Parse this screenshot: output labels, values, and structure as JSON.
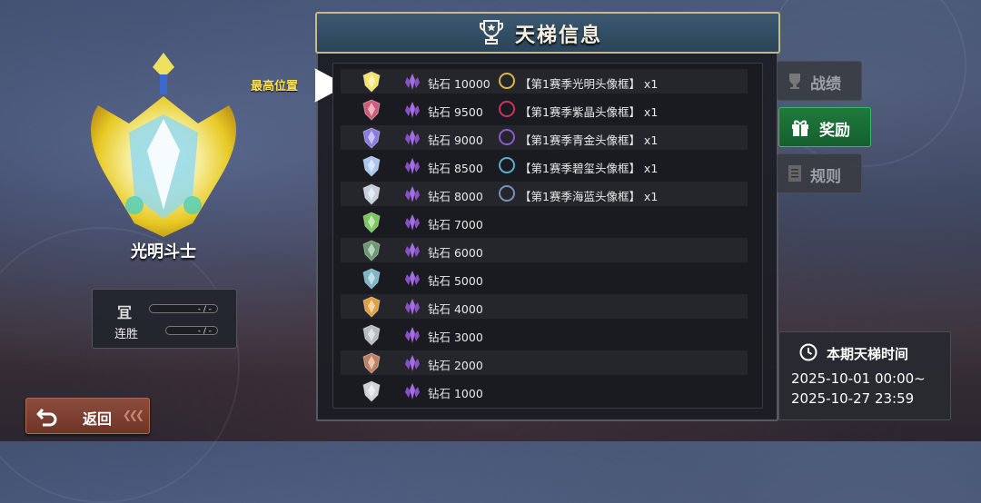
{
  "title": "天梯信息",
  "rank": {
    "name": "光明斗士"
  },
  "stats": {
    "row1_icon": "冝",
    "row1_value": "- / -",
    "row2_label": "连胜",
    "row2_value": "- / -"
  },
  "back_label": "返回",
  "highest_label": "最高位置",
  "tabs": [
    {
      "label": "战绩",
      "active": false,
      "icon": "trophy-icon"
    },
    {
      "label": "奖励",
      "active": true,
      "icon": "gift-icon"
    },
    {
      "label": "规则",
      "active": false,
      "icon": "document-icon"
    }
  ],
  "season": {
    "title": "本期天梯时间",
    "start": "2025-10-01 00:00~",
    "end": "2025-10-27 23:59"
  },
  "tiers": [
    {
      "label": "钻石 10000",
      "reward": "【第1赛季光明头像框】 x1",
      "rank_color": "#f6e46a",
      "ring_color": "#d9b64a"
    },
    {
      "label": "钻石 9500",
      "reward": "【第1赛季紫晶头像框】 x1",
      "rank_color": "#d05a7a",
      "ring_color": "#c8345a"
    },
    {
      "label": "钻石 9000",
      "reward": "【第1赛季青金头像框】 x1",
      "rank_color": "#8a7be0",
      "ring_color": "#8a5ad0"
    },
    {
      "label": "钻石 8500",
      "reward": "【第1赛季碧玺头像框】 x1",
      "rank_color": "#a8c8f0",
      "ring_color": "#5ab0c8"
    },
    {
      "label": "钻石 8000",
      "reward": "【第1赛季海蓝头像框】 x1",
      "rank_color": "#c8d0e0",
      "ring_color": "#7a90b8"
    },
    {
      "label": "钻石 7000",
      "reward": "",
      "rank_color": "#7ac85a"
    },
    {
      "label": "钻石 6000",
      "reward": "",
      "rank_color": "#6a9a70"
    },
    {
      "label": "钻石 5000",
      "reward": "",
      "rank_color": "#7ab8c8"
    },
    {
      "label": "钻石 4000",
      "reward": "",
      "rank_color": "#e0a040"
    },
    {
      "label": "钻石 3000",
      "reward": "",
      "rank_color": "#b8bcc4"
    },
    {
      "label": "钻石 2000",
      "reward": "",
      "rank_color": "#c08060"
    },
    {
      "label": "钻石 1000",
      "reward": "",
      "rank_color": "#d0d4d8"
    }
  ],
  "colors": {
    "accent_green": "#1e7a3c",
    "gold": "#ffe25a",
    "gem": "#a070e0"
  }
}
